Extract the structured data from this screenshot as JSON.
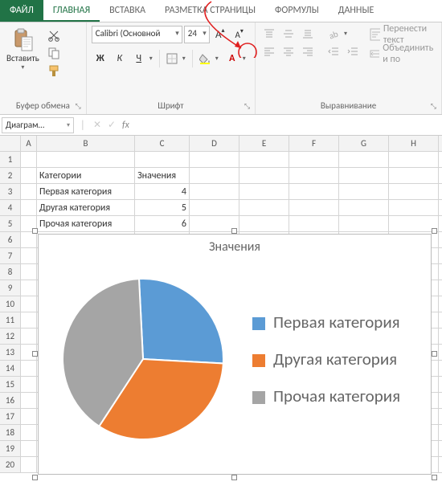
{
  "tabs": {
    "file": "ФАЙЛ",
    "home": "ГЛАВНАЯ",
    "insert": "ВСТАВКА",
    "layout": "РАЗМЕТКА СТРАНИЦЫ",
    "formulas": "ФОРМУЛЫ",
    "data": "ДАННЫЕ"
  },
  "ribbon": {
    "paste": "Вставить",
    "clipboard_label": "Буфер обмена",
    "font_name": "Calibri (Основной",
    "font_size": "24",
    "bold": "Ж",
    "italic": "К",
    "under": "Ч",
    "font_label": "Шрифт",
    "wrap": "Перенести текст",
    "merge": "Объединить и по",
    "align_label": "Выравнивание",
    "increase_font_title": "Увеличить размер шрифта",
    "decrease_font_title": "Уменьшить размер шрифта"
  },
  "namebox": "Диаграм…",
  "columns": [
    "A",
    "B",
    "C",
    "D",
    "E",
    "F",
    "G",
    "H"
  ],
  "rows": [
    "1",
    "2",
    "3",
    "4",
    "5",
    "6",
    "7",
    "8",
    "9",
    "10",
    "11",
    "12",
    "13",
    "14",
    "15",
    "16",
    "17",
    "18",
    "19",
    "20"
  ],
  "cells": {
    "B2": "Категории",
    "C2": "Значения",
    "B3": "Первая категория",
    "C3": "4",
    "B4": "Другая категория",
    "C4": "5",
    "B5": "Прочая категория",
    "C5": "6"
  },
  "chart_data": {
    "type": "pie",
    "title": "Значения",
    "categories": [
      "Первая категория",
      "Другая категория",
      "Прочая категория"
    ],
    "values": [
      4,
      5,
      6
    ],
    "colors": [
      "#5b9bd5",
      "#ed7d31",
      "#a5a5a5"
    ],
    "legend_position": "right"
  }
}
